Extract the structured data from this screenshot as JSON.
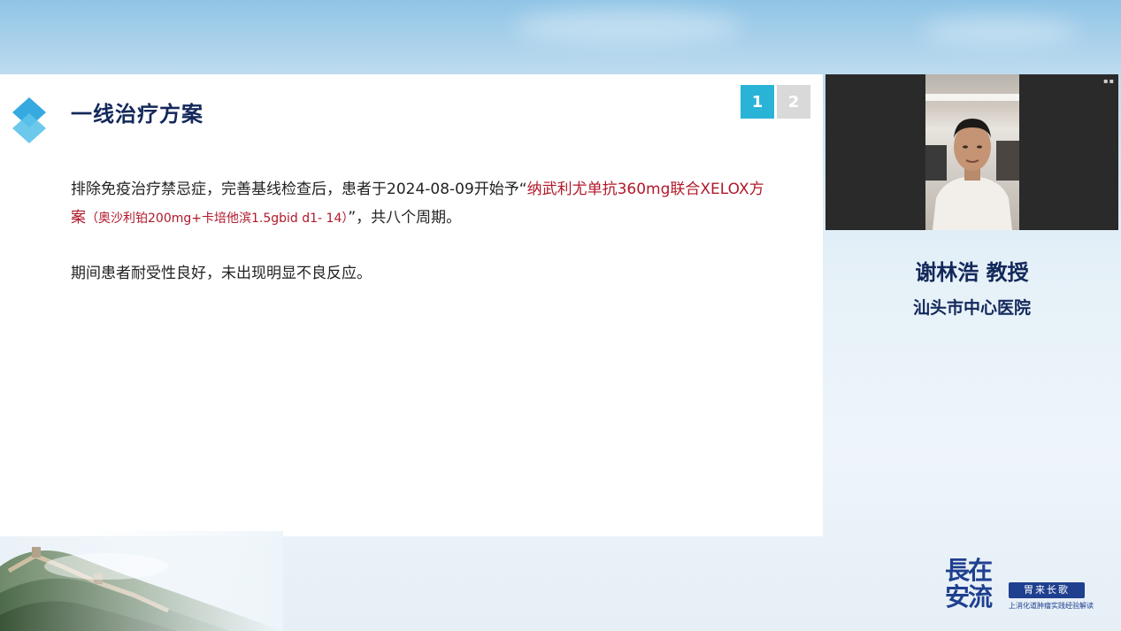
{
  "slide": {
    "title": "一线治疗方案",
    "pages": [
      "1",
      "2"
    ],
    "active_page": 0,
    "paragraph1": {
      "part1": "排除免疫治疗禁忌症，完善基线检查后，患者于2024-08-09开始予“",
      "highlight": "纳武利尤单抗360mg联合XELOX方案",
      "detail": "（奥沙利铂200mg+卡培他滨1.5gbid d1- 14）",
      "part2": "”，共八个周期。"
    },
    "paragraph2": "期间患者耐受性良好，未出现明显不良反应。"
  },
  "speaker": {
    "name": "谢林浩 教授",
    "hospital": "汕头市中心医院"
  },
  "brand": {
    "main": "長在安流",
    "tagline": "胃来长歌",
    "subtitle": "上消化道肿瘤实践经验解读"
  },
  "colors": {
    "accent": "#29b3d6",
    "title": "#13285a",
    "highlight": "#b0182a"
  }
}
